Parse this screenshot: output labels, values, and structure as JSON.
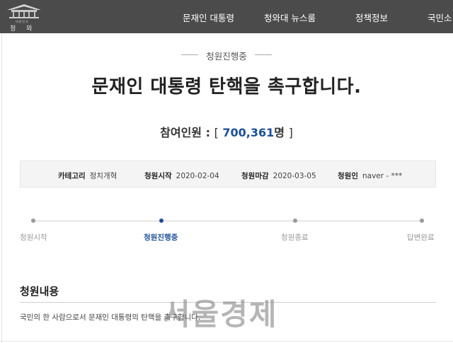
{
  "header": {
    "logo": {
      "sub_text": "대한민국",
      "text": "청 와 대"
    },
    "nav": [
      {
        "label": "문재인 대통령"
      },
      {
        "label": "청와대 뉴스룸"
      },
      {
        "label": "정책정보"
      },
      {
        "label": "국민소"
      }
    ]
  },
  "petition": {
    "status": "청원진행중",
    "title": "문재인 대통령 탄핵을 촉구합니다.",
    "participants": {
      "label": "참여인원 :",
      "open_bracket": "[",
      "count": "700,361",
      "unit": "명",
      "close_bracket": "]"
    },
    "info": [
      {
        "key": "카테고리",
        "value": "정치개혁"
      },
      {
        "key": "청원시작",
        "value": "2020-02-04"
      },
      {
        "key": "청원마감",
        "value": "2020-03-05"
      },
      {
        "key": "청원인",
        "value": "naver - ***"
      }
    ],
    "progress": {
      "steps": [
        {
          "label": "청원시작",
          "active": false
        },
        {
          "label": "청원진행중",
          "active": true
        },
        {
          "label": "청원종료",
          "active": false
        },
        {
          "label": "답변완료",
          "active": false
        }
      ]
    },
    "content": {
      "heading": "청원내용",
      "body": "국민의 한 사람으로서 문재인 대통령의 탄핵을 촉구합니다."
    }
  },
  "watermark": "서울경제",
  "colors": {
    "topbar": "#4b4b4b",
    "accent": "#1d5096",
    "info_bg": "#f4f4f4"
  }
}
